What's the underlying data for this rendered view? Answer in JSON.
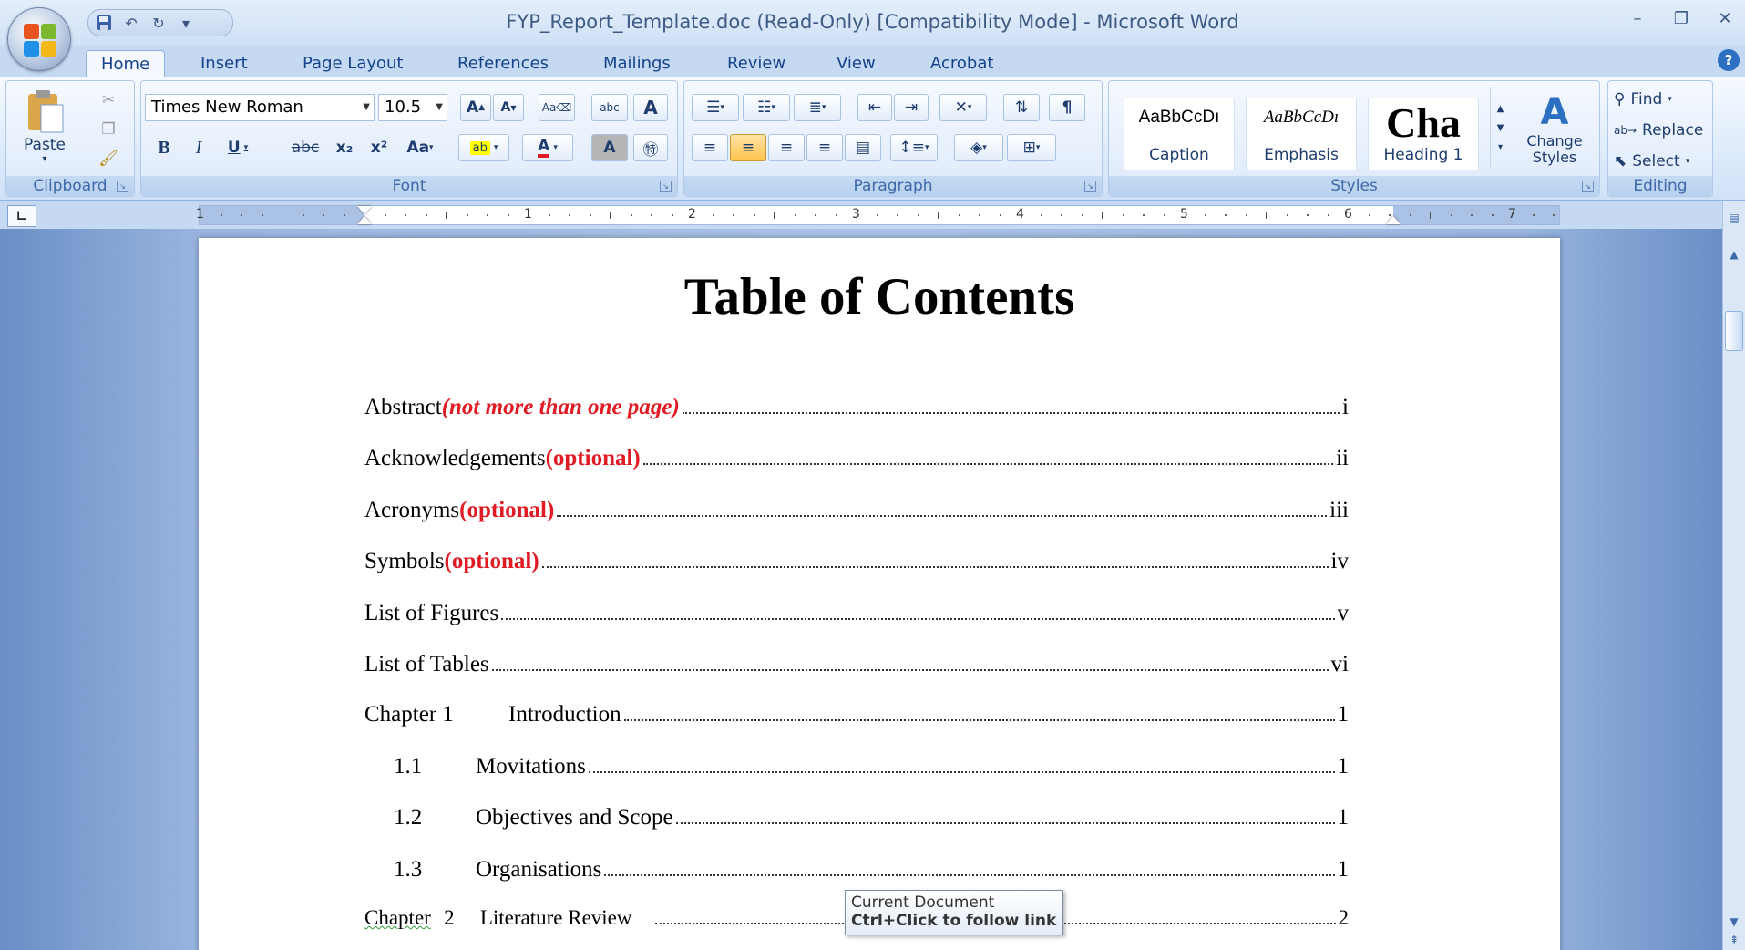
{
  "window": {
    "title": "FYP_Report_Template.doc (Read-Only) [Compatibility Mode] - Microsoft Word",
    "controls": [
      "minimize",
      "restore",
      "close"
    ]
  },
  "quick_access": {
    "more": "▾"
  },
  "tabs": [
    "Home",
    "Insert",
    "Page Layout",
    "References",
    "Mailings",
    "Review",
    "View",
    "Acrobat"
  ],
  "active_tab": "Home",
  "ribbon": {
    "clipboard": {
      "label": "Clipboard",
      "paste": "Paste"
    },
    "font": {
      "label": "Font",
      "font_name": "Times New Roman",
      "font_size": "10.5",
      "bold": "B",
      "italic": "I",
      "underline": "U",
      "strike": "abc",
      "subscript": "x₂",
      "superscript": "x²",
      "change_case": "Aa",
      "font_color": "A",
      "grow": "A",
      "shrink": "A"
    },
    "paragraph": {
      "label": "Paragraph",
      "pilcrow": "¶"
    },
    "styles": {
      "label": "Styles",
      "tiles": [
        {
          "sample": "AaBbCcDı",
          "name": "Caption"
        },
        {
          "sample": "AaBbCcDı",
          "name": "Emphasis"
        },
        {
          "sample": "Cha",
          "name": "Heading 1"
        }
      ],
      "change_styles": "Change Styles"
    },
    "editing": {
      "label": "Editing",
      "find": "Find",
      "replace": "Replace",
      "select": "Select"
    }
  },
  "ruler": {
    "numbers": [
      "1",
      "1",
      "2",
      "3",
      "4",
      "5",
      "6",
      "7"
    ]
  },
  "document": {
    "title": "Table of Contents",
    "toc": [
      {
        "text": "Abstract ",
        "note": "(not more than one page)",
        "note_italic": true,
        "page": "i"
      },
      {
        "text": "Acknowledgements ",
        "note": "(optional)",
        "note_italic": false,
        "page": "ii"
      },
      {
        "text": "Acronyms ",
        "note": "(optional)",
        "note_italic": false,
        "page": "iii"
      },
      {
        "text": "Symbols ",
        "note": "(optional)",
        "note_italic": false,
        "page": "iv"
      },
      {
        "text": "List of Figures",
        "note": "",
        "page": "v"
      },
      {
        "text": "List of Tables",
        "note": "",
        "page": "vi"
      },
      {
        "num": "Chapter 1",
        "text": "Introduction",
        "page": "1"
      },
      {
        "num": "1.1",
        "text": "Movitations",
        "page": "1"
      },
      {
        "num": "1.2",
        "text": "Objectives and Scope",
        "page": "1"
      },
      {
        "num": "1.3",
        "text": "Organisations",
        "page": "1"
      },
      {
        "num": "Chapter",
        "num2": "2",
        "text": "Literature Review",
        "page": "2"
      }
    ]
  },
  "tooltip": {
    "line1": "Current Document",
    "line2": "Ctrl+Click to follow link"
  }
}
